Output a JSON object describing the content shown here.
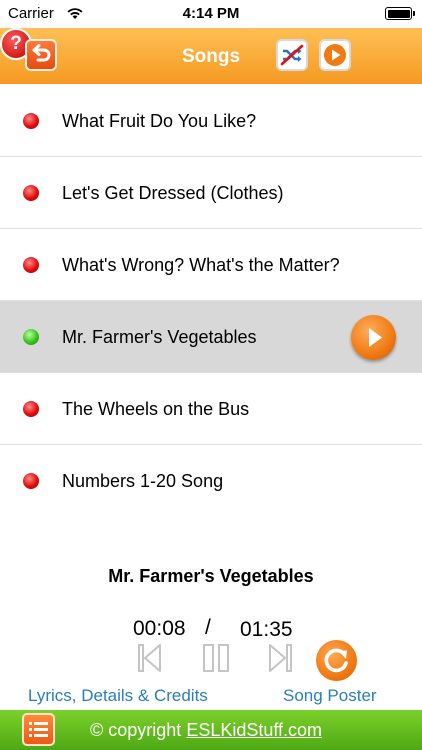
{
  "status_bar": {
    "carrier": "Carrier",
    "time": "4:14 PM"
  },
  "header": {
    "title": "Songs"
  },
  "songs": [
    {
      "title": "What Fruit Do You Like?",
      "state": "red"
    },
    {
      "title": "Let's Get Dressed (Clothes)",
      "state": "red"
    },
    {
      "title": "What's Wrong? What's the Matter?",
      "state": "red"
    },
    {
      "title": "Mr. Farmer's Vegetables",
      "state": "green"
    },
    {
      "title": "The Wheels on the Bus",
      "state": "red"
    },
    {
      "title": "Numbers 1-20 Song",
      "state": "red"
    }
  ],
  "player": {
    "now_playing": "Mr. Farmer's Vegetables",
    "elapsed": "00:08",
    "separator": "/",
    "total": "01:35"
  },
  "links": {
    "lyrics": "Lyrics, Details & Credits",
    "poster": "Song Poster"
  },
  "footer": {
    "copyright_prefix": "© copyright ",
    "site": "ESLKidStuff.com"
  },
  "icons": {
    "back": "back-arrow-icon",
    "shuffle": "shuffle-off-icon",
    "play_all": "play-icon",
    "help": "help-icon",
    "menu": "list-menu-icon",
    "repeat": "repeat-icon"
  },
  "colors": {
    "accent_orange": "#f59a22",
    "footer_green": "#5cb81c",
    "link_blue": "#2a7fb5",
    "selected_row": "#d8d8d8"
  }
}
